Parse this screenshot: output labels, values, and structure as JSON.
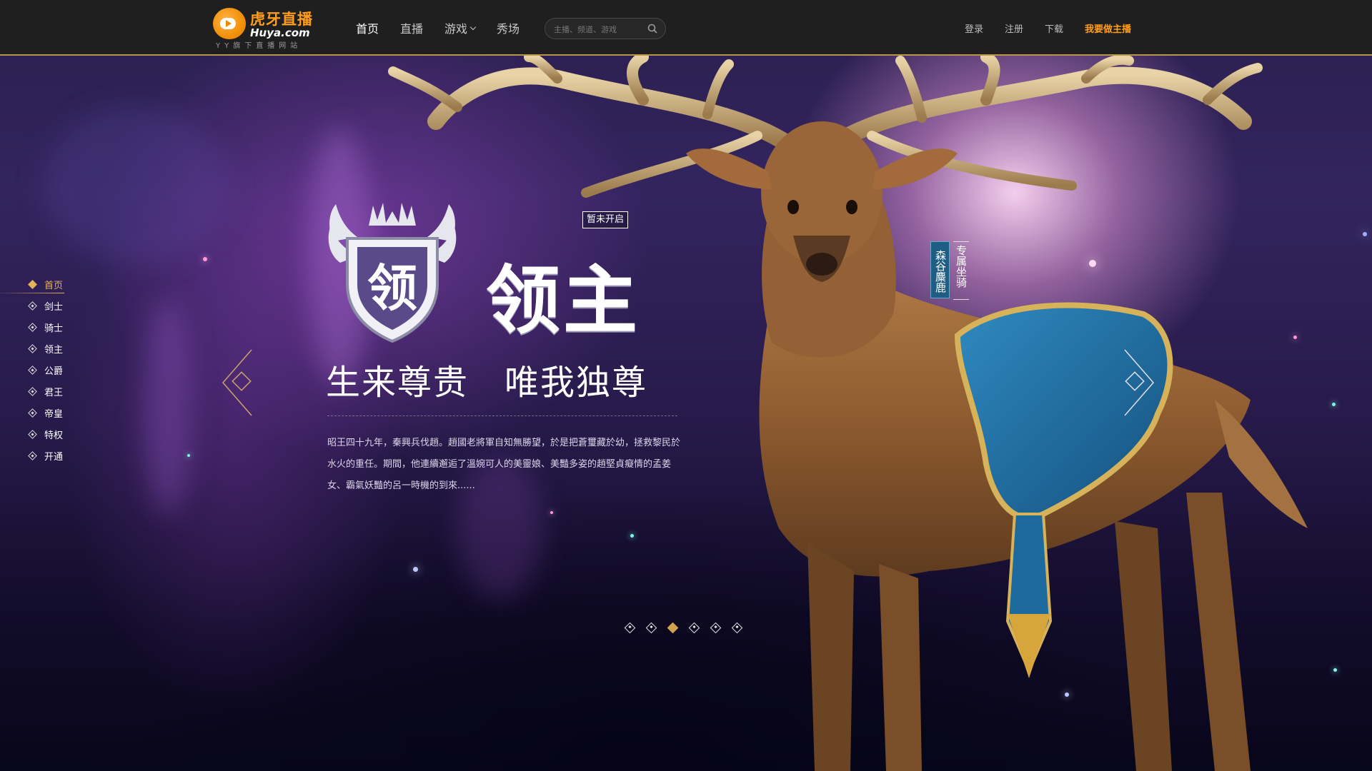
{
  "header": {
    "logo": {
      "cn": "虎牙直播",
      "en": "Huya.com",
      "sub": "YY旗下直播网站"
    },
    "nav": [
      {
        "label": "首页",
        "active": true
      },
      {
        "label": "直播"
      },
      {
        "label": "游戏",
        "has_dropdown": true
      },
      {
        "label": "秀场"
      }
    ],
    "search": {
      "placeholder": "主播、频道、游戏",
      "icon": "search-icon"
    },
    "right_links": [
      "登录",
      "注册",
      "下载"
    ],
    "cta": "我要做主播"
  },
  "sidebar": {
    "items": [
      {
        "label": "首页",
        "active": true
      },
      {
        "label": "剑士"
      },
      {
        "label": "骑士"
      },
      {
        "label": "领主"
      },
      {
        "label": "公爵"
      },
      {
        "label": "君王"
      },
      {
        "label": "帝皇"
      },
      {
        "label": "特权"
      },
      {
        "label": "开通"
      }
    ]
  },
  "hero": {
    "crest_char": "领",
    "title": "领主",
    "badge": "暂未开启",
    "slogan": "生来尊贵　唯我独尊",
    "description": "昭王四十九年，秦興兵伐趙。趙國老將軍自知無勝望，於是把蒼璽藏於幼，拯救黎民於水火的重任。期間，他連續邂逅了溫婉可人的美靈娘、美豔多姿的趙堅貞癡情的孟姜女、霸氣妖豔的呂一時機的到來......",
    "mount": {
      "name": "森谷麋鹿",
      "label": "专属坐骑"
    }
  },
  "carousel": {
    "count": 6,
    "active_index": 2,
    "prev_icon": "chevron-left-icon",
    "next_icon": "chevron-right-icon"
  },
  "colors": {
    "accent": "#e5b25c",
    "brand_orange": "#ff9d1a",
    "topbar_bg": "#1f1f1f",
    "saddle_blue": "#1e6fa6"
  }
}
